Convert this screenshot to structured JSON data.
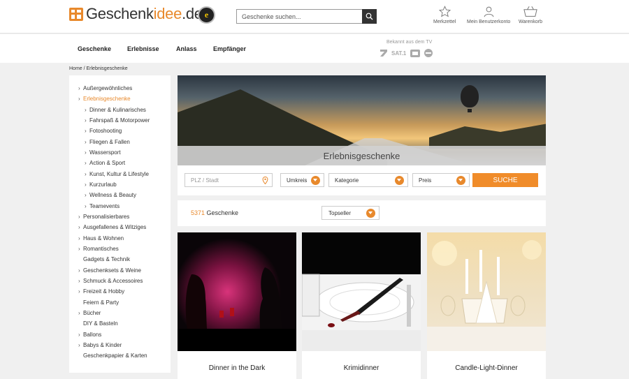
{
  "header": {
    "logo_text_a": "Geschenk",
    "logo_text_b": "idee",
    "logo_text_c": ".de",
    "trust_badge": "e",
    "search_placeholder": "Geschenke suchen...",
    "icons": [
      {
        "name": "star-icon",
        "label": "Merkzettel"
      },
      {
        "name": "user-icon",
        "label": "Mein Benutzerkonto"
      },
      {
        "name": "basket-icon",
        "label": "Warenkorb"
      }
    ]
  },
  "nav": {
    "items": [
      "Geschenke",
      "Erlebnisse",
      "Anlass",
      "Empfänger"
    ],
    "tv_label": "Bekannt aus dem TV",
    "tv_logos": [
      "SAT.1"
    ]
  },
  "breadcrumb": "Home / Erlebnisgeschenke",
  "sidebar": {
    "items": [
      {
        "label": "Außergewöhnliches",
        "chevron": true,
        "level": 0
      },
      {
        "label": "Erlebnisgeschenke",
        "chevron": true,
        "level": 0,
        "active": true
      },
      {
        "label": "Dinner & Kulinarisches",
        "chevron": true,
        "level": 1
      },
      {
        "label": "Fahrspaß & Motorpower",
        "chevron": true,
        "level": 1
      },
      {
        "label": "Fotoshooting",
        "chevron": true,
        "level": 1
      },
      {
        "label": "Fliegen & Fallen",
        "chevron": true,
        "level": 1
      },
      {
        "label": "Wassersport",
        "chevron": true,
        "level": 1
      },
      {
        "label": "Action & Sport",
        "chevron": true,
        "level": 1
      },
      {
        "label": "Kunst, Kultur & Lifestyle",
        "chevron": true,
        "level": 1
      },
      {
        "label": "Kurzurlaub",
        "chevron": true,
        "level": 1
      },
      {
        "label": "Wellness & Beauty",
        "chevron": true,
        "level": 1
      },
      {
        "label": "Teamevents",
        "chevron": true,
        "level": 1
      },
      {
        "label": "Personalisierbares",
        "chevron": true,
        "level": 0
      },
      {
        "label": "Ausgefallenes & Witziges",
        "chevron": true,
        "level": 0
      },
      {
        "label": "Haus & Wohnen",
        "chevron": true,
        "level": 0
      },
      {
        "label": "Romantisches",
        "chevron": true,
        "level": 0
      },
      {
        "label": "Gadgets & Technik",
        "chevron": false,
        "level": 0
      },
      {
        "label": "Geschenksets & Weine",
        "chevron": true,
        "level": 0
      },
      {
        "label": "Schmuck & Accessoires",
        "chevron": true,
        "level": 0
      },
      {
        "label": "Freizeit & Hobby",
        "chevron": true,
        "level": 0
      },
      {
        "label": "Feiern & Party",
        "chevron": false,
        "level": 0
      },
      {
        "label": "Bücher",
        "chevron": true,
        "level": 0
      },
      {
        "label": "DIY & Basteln",
        "chevron": false,
        "level": 0
      },
      {
        "label": "Ballons",
        "chevron": true,
        "level": 0
      },
      {
        "label": "Babys & Kinder",
        "chevron": true,
        "level": 0
      },
      {
        "label": "Geschenkpapier & Karten",
        "chevron": false,
        "level": 0
      }
    ]
  },
  "hero": {
    "title": "Erlebnisgeschenke"
  },
  "filters": {
    "location_placeholder": "PLZ / Stadt",
    "radius": "Umkreis",
    "category": "Kategorie",
    "price": "Preis",
    "search_button": "SUCHE"
  },
  "results": {
    "count": "5371",
    "count_label": " Geschenke",
    "sort": "Topseller"
  },
  "products": [
    {
      "title": "Dinner in the Dark"
    },
    {
      "title": "Krimidinner"
    },
    {
      "title": "Candle-Light-Dinner"
    }
  ],
  "colors": {
    "accent": "#e8892c",
    "button": "#f08c2a"
  }
}
